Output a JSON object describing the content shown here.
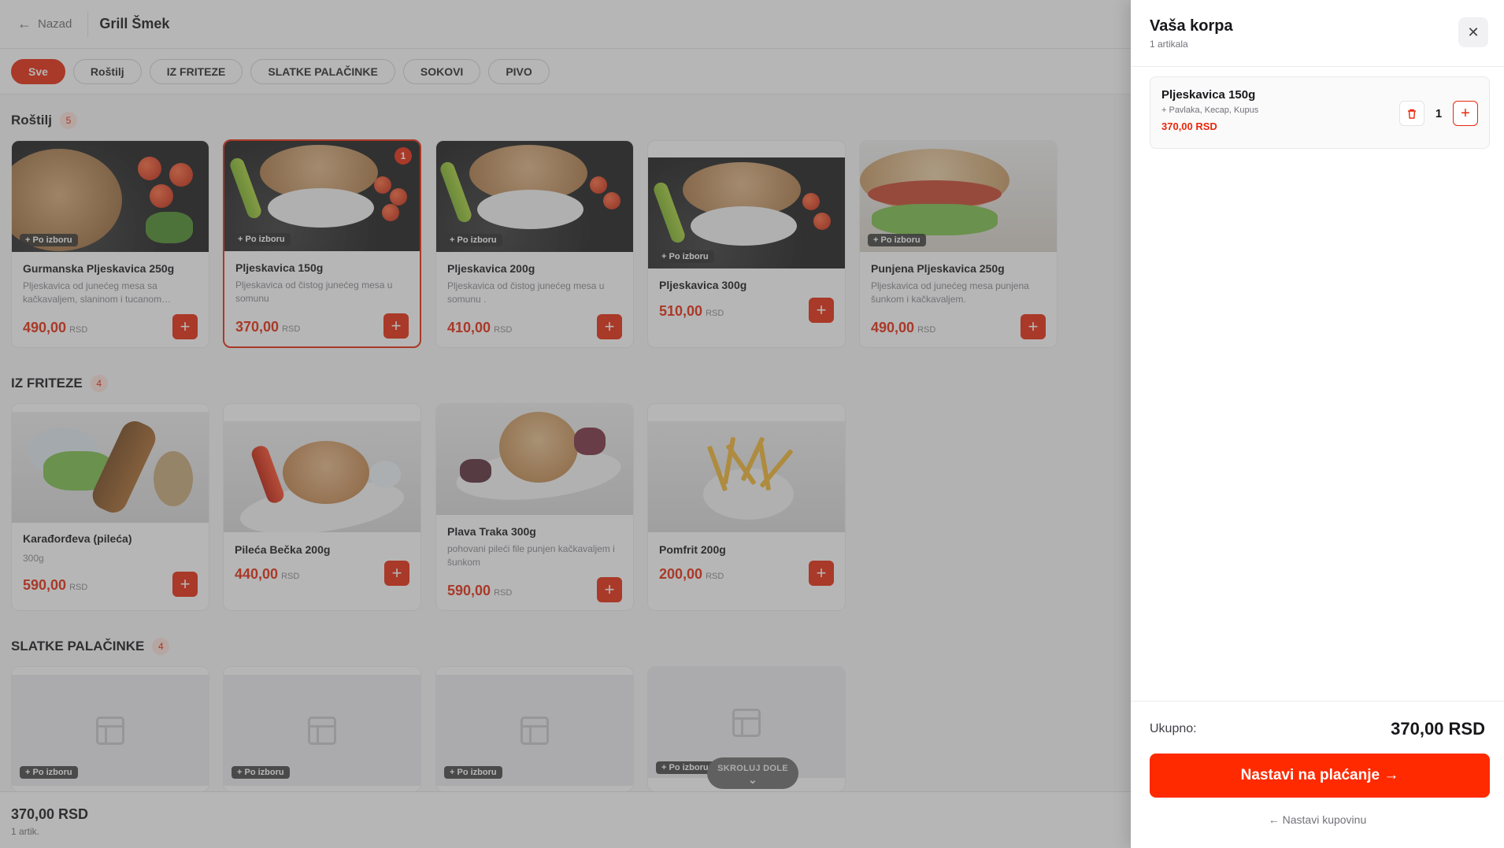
{
  "topbar": {
    "back_label": "Nazad",
    "store_name": "Grill Šmek"
  },
  "filters": [
    "Sve",
    "Roštilj",
    "IZ FRITEZE",
    "SLATKE PALAČINKE",
    "SOKOVI",
    "PIVO"
  ],
  "sections": [
    {
      "title": "Roštilj",
      "count": "5"
    },
    {
      "title": "IZ FRITEZE",
      "count": "4"
    },
    {
      "title": "SLATKE PALAČINKE",
      "count": "4"
    }
  ],
  "currency": "RSD",
  "option_badge": "+ Po izboru",
  "grill_items": [
    {
      "name": "Gurmanska Pljeskavica 250g",
      "desc": "Pljeskavica od junećeg mesa sa kačkavaljem, slaninom i tucanom…",
      "price": "490,00"
    },
    {
      "name": "Pljeskavica 150g",
      "desc": "Pljeskavica od čistog junećeg mesa u somunu",
      "price": "370,00",
      "in_cart": "1"
    },
    {
      "name": "Pljeskavica 200g",
      "desc": "Pljeskavica od čistog junećeg mesa u somunu .",
      "price": "410,00"
    },
    {
      "name": "Pljeskavica 300g",
      "desc": "",
      "price": "510,00"
    },
    {
      "name": "Punjena Pljeskavica 250g",
      "desc": "Pljeskavica od junećeg mesa punjena šunkom i kačkavaljem.",
      "price": "490,00"
    }
  ],
  "fryer_items": [
    {
      "name": "Karađorđeva (pileća)",
      "desc": "300g",
      "price": "590,00"
    },
    {
      "name": "Pileća Bečka 200g",
      "desc": "",
      "price": "440,00"
    },
    {
      "name": "Plava Traka 300g",
      "desc": "pohovani pileći file punjen kačkavaljem i šunkom",
      "price": "590,00"
    },
    {
      "name": "Pomfrit 200g",
      "desc": "",
      "price": "200,00"
    }
  ],
  "scroll_hint": "SKROLUJ DOLE",
  "bottom_bar": {
    "total": "370,00 RSD",
    "count": "1 artik."
  },
  "cart": {
    "title": "Vaša korpa",
    "subtitle": "1 artikala",
    "item": {
      "name": "Pljeskavica 150g",
      "extras": "+ Pavlaka, Kecap, Kupus",
      "price": "370,00 RSD",
      "qty": "1"
    },
    "total_label": "Ukupno:",
    "total_value": "370,00 RSD",
    "checkout_label": "Nastavi na plaćanje →",
    "continue_label": "← Nastavi kupovinu"
  },
  "colors": {
    "accent": "#e8280c",
    "checkout": "#ff2a00",
    "overlay": "rgba(80,80,80,0.42)"
  }
}
